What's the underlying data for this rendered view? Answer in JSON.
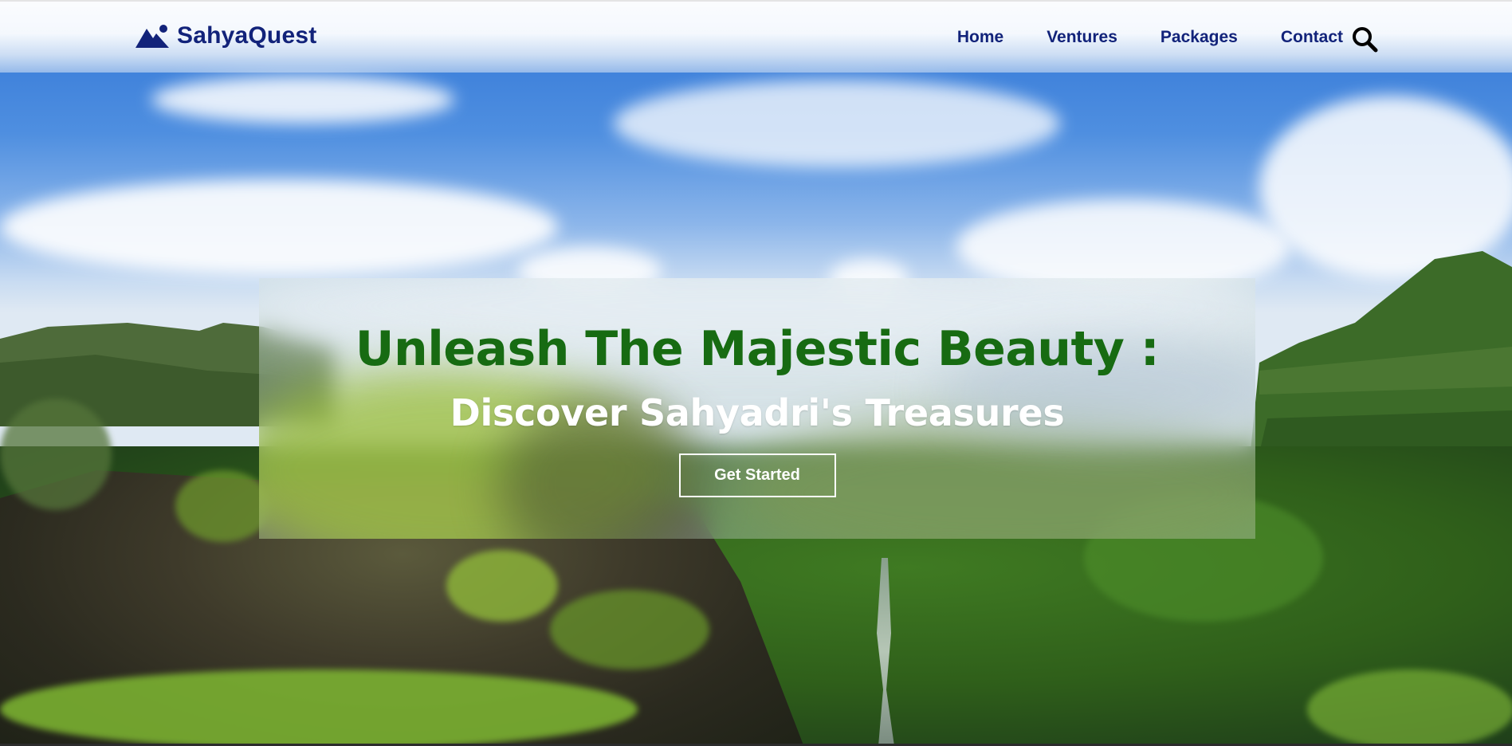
{
  "brand": {
    "name": "SahyaQuest",
    "icon": "mountain-icon",
    "color": "#12237a"
  },
  "nav": {
    "items": [
      {
        "label": "Home"
      },
      {
        "label": "Ventures"
      },
      {
        "label": "Packages"
      },
      {
        "label": "Contact"
      }
    ],
    "search_icon": "search-icon"
  },
  "hero": {
    "headline": "Unleash The Majestic Beauty :",
    "subheadline": "Discover Sahyadri's Treasures",
    "cta_label": "Get Started",
    "headline_color": "#176b12",
    "subheadline_color": "#ffffff"
  }
}
